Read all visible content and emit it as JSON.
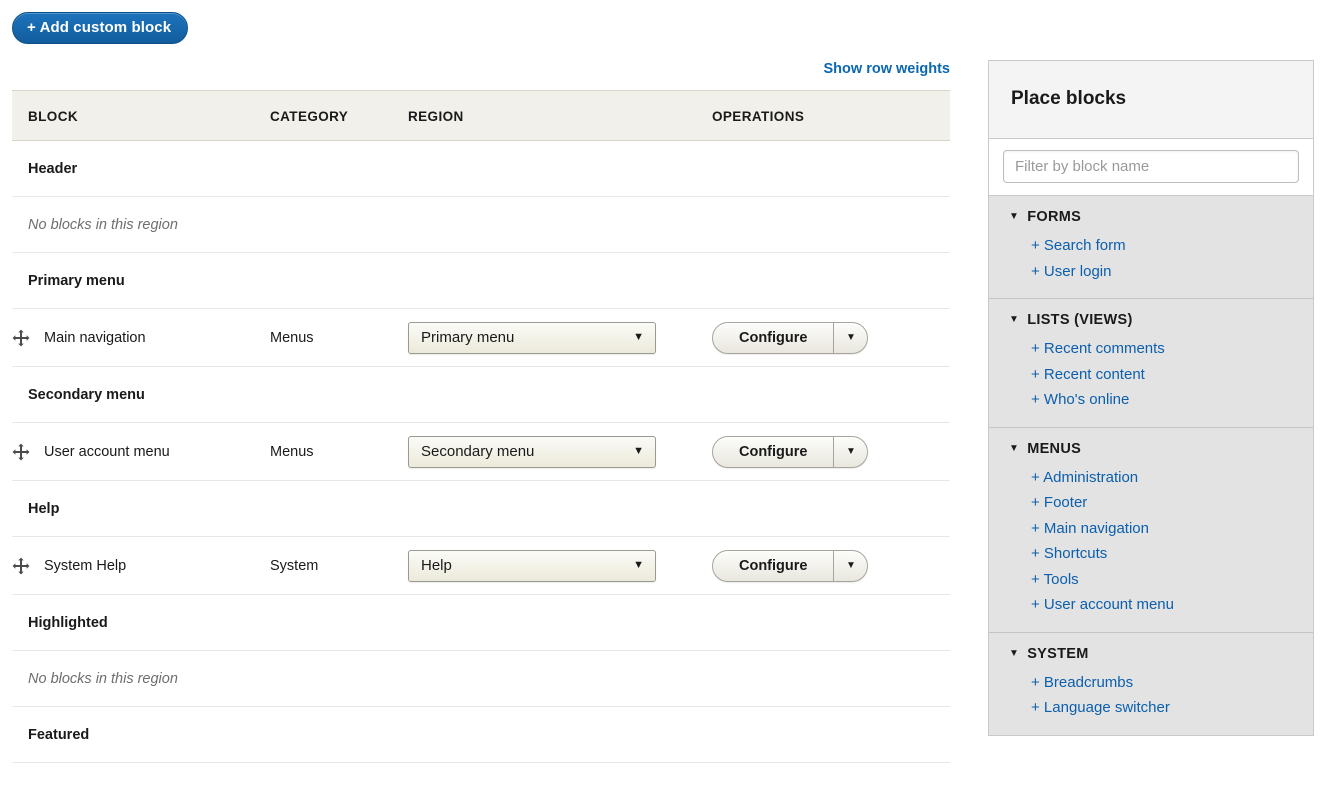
{
  "toolbar": {
    "add_custom_block_label": "+ Add custom block"
  },
  "table_actions": {
    "show_row_weights_label": "Show row weights"
  },
  "table": {
    "columns": {
      "block": "BLOCK",
      "category": "CATEGORY",
      "region": "REGION",
      "operations": "OPERATIONS"
    },
    "empty_text": "No blocks in this region",
    "rows": [
      {
        "type": "region",
        "region": "Header"
      },
      {
        "type": "empty",
        "text": "No blocks in this region"
      },
      {
        "type": "region",
        "region": "Primary menu"
      },
      {
        "type": "block",
        "block": "Main navigation",
        "category": "Menus",
        "region_value": "Primary menu",
        "operation": "Configure"
      },
      {
        "type": "region",
        "region": "Secondary menu"
      },
      {
        "type": "block",
        "block": "User account menu",
        "category": "Menus",
        "region_value": "Secondary menu",
        "operation": "Configure"
      },
      {
        "type": "region",
        "region": "Help"
      },
      {
        "type": "block",
        "block": "System Help",
        "category": "System",
        "region_value": "Help",
        "operation": "Configure"
      },
      {
        "type": "region",
        "region": "Highlighted"
      },
      {
        "type": "empty",
        "text": "No blocks in this region"
      },
      {
        "type": "region",
        "region": "Featured"
      }
    ]
  },
  "sidebar": {
    "title": "Place blocks",
    "filter_placeholder": "Filter by block name",
    "filter_value": "",
    "sections": [
      {
        "title": "FORMS",
        "expanded": true,
        "links": [
          "+ Search form",
          "+ User login"
        ]
      },
      {
        "title": "LISTS (VIEWS)",
        "expanded": true,
        "links": [
          "+ Recent comments",
          "+ Recent content",
          "+ Who's online"
        ]
      },
      {
        "title": "MENUS",
        "expanded": true,
        "links": [
          "+ Administration",
          "+ Footer",
          "+ Main navigation",
          "+ Shortcuts",
          "+ Tools",
          "+ User account menu"
        ]
      },
      {
        "title": "SYSTEM",
        "expanded": true,
        "links": [
          "+ Breadcrumbs",
          "+ Language switcher"
        ]
      }
    ]
  },
  "colors": {
    "primary_button": "#125c9c",
    "link": "#0b5fae",
    "table_header_bg": "#f1f0ea",
    "sidebar_section_bg": "#e3e3e3"
  }
}
